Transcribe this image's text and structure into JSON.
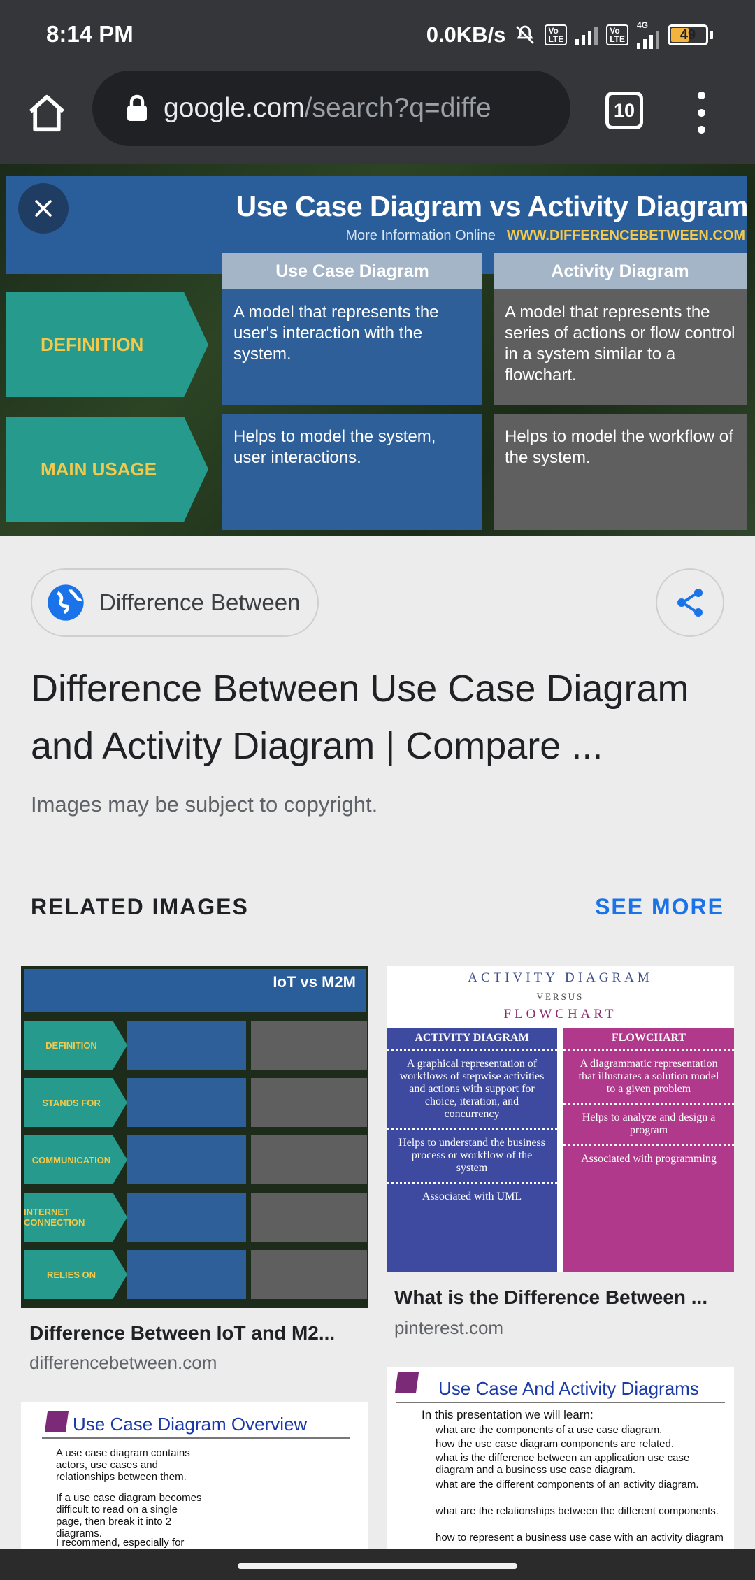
{
  "status_bar": {
    "time": "8:14 PM",
    "network_speed": "0.0KB/s",
    "network_label": "4G",
    "battery_level": "49",
    "battery_fraction": 0.49
  },
  "toolbar": {
    "url_host": "google.com",
    "url_path": "/search?q=diffe",
    "tab_count": "10"
  },
  "hero_image": {
    "title": "Use Case Diagram vs Activity Diagram",
    "more_info": "More Information  Online",
    "site": "WWW.DIFFERENCEBETWEEN.COM",
    "col1": "Use Case Diagram",
    "col2": "Activity Diagram",
    "row1_label": "DEFINITION",
    "row1_c1": "A model that represents the user's interaction with the system.",
    "row1_c2": "A model that represents the series of actions or flow control in a system similar to a flowchart.",
    "row2_label": "MAIN USAGE",
    "row2_c1": "Helps to model the system, user interactions.",
    "row2_c2": "Helps to model the workflow of the system."
  },
  "source": {
    "chip_label": "Difference Between"
  },
  "result": {
    "title": "Difference Between Use Case Diagram and Activity Diagram | Compare ...",
    "copyright": "Images may be subject to copyright."
  },
  "related": {
    "heading": "RELATED IMAGES",
    "see_more": "SEE MORE",
    "items": [
      {
        "caption": "Difference Between IoT and M2...",
        "source": "differencebetween.com",
        "thumb_title": "IoT vs M2M",
        "row_labels": [
          "DEFINITION",
          "STANDS FOR",
          "COMMUNICATION",
          "INTERNET CONNECTION",
          "RELIES ON"
        ]
      },
      {
        "caption": "What is the Difference Between ...",
        "source": "pinterest.com",
        "thumb_title1": "ACTIVITY DIAGRAM",
        "thumb_vs": "VERSUS",
        "thumb_title2": "FLOWCHART",
        "col_a": "ACTIVITY DIAGRAM",
        "col_b": "FLOWCHART",
        "col_a_text": "A graphical representation of workflows of stepwise activities and actions with support for choice, iteration, and concurrency",
        "col_b_text": "A diagrammatic representation that illustrates a solution model to a given problem",
        "col_a_text2": "Helps to understand the business process or workflow of the system",
        "col_b_text2": "Helps to analyze and design a program",
        "col_a_text3": "Associated with UML",
        "col_b_text3": "Associated with programming"
      },
      {
        "thumb_title": "Use Case Diagram Overview",
        "bullets": [
          "A use case diagram contains actors, use cases and relationships between them.",
          "If a use case diagram becomes difficult to read on a single page, then break it into 2 diagrams.",
          "I recommend, especially for"
        ]
      },
      {
        "thumb_title": "Use Case And Activity Diagrams",
        "intro": "In this presentation we will learn:",
        "bullets": [
          "what are the components of a use case diagram.",
          "how the use case diagram components are related.",
          "what is the difference between an application use case diagram and a business use case diagram.",
          "what are the different components of an activity diagram.",
          "what are the relationships between the different components.",
          "how to represent a business use case with an activity diagram"
        ]
      }
    ]
  },
  "colors": {
    "chrome_dark": "#35363a",
    "accent_blue": "#1a73e8",
    "page_bg": "#ececec"
  }
}
